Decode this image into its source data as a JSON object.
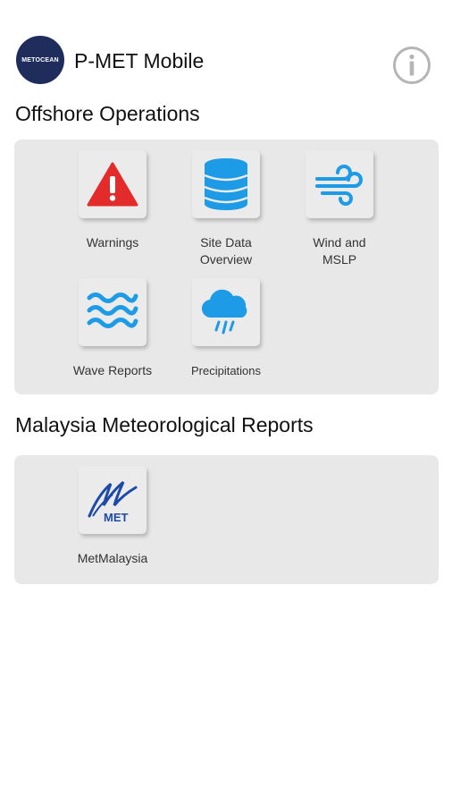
{
  "header": {
    "logo_text": "METOCEAN",
    "title": "P-MET Mobile",
    "info_icon": "info-circle-icon"
  },
  "offshore": {
    "title": "Offshore Operations",
    "tiles": [
      {
        "label": "Warnings",
        "icon": "warning-triangle-icon"
      },
      {
        "label": "Site Data\nOverview",
        "icon": "database-icon"
      },
      {
        "label": "Wind and\nMSLP",
        "icon": "wind-icon"
      },
      {
        "label": "Wave Reports",
        "icon": "wave-icon"
      },
      {
        "label": "Precipitations",
        "icon": "rain-cloud-icon"
      }
    ]
  },
  "malaysia": {
    "title": "Malaysia Meteorological Reports",
    "tiles": [
      {
        "label": "MetMalaysia",
        "icon": "metmalaysia-logo-icon",
        "logo_text": "MET"
      }
    ]
  },
  "colors": {
    "accent_blue": "#1e9be6",
    "warning_red": "#e32b2b",
    "panel_bg": "#e8e8e8",
    "logo_navy": "#1f2d5c"
  }
}
